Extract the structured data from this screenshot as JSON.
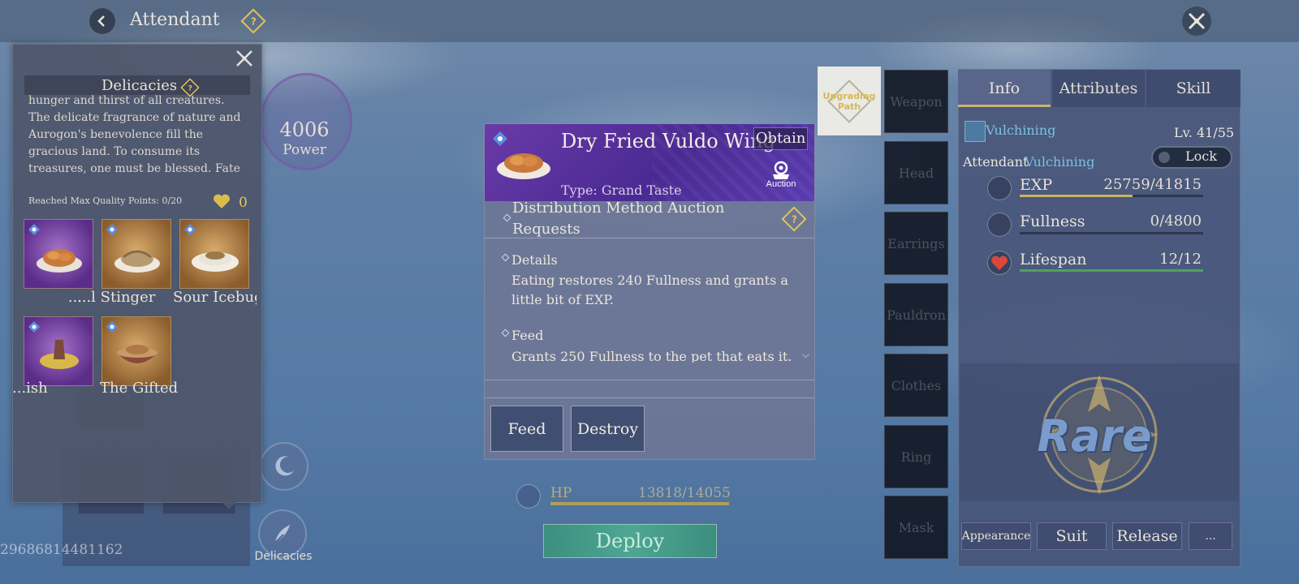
{
  "topbar": {
    "title": "Attendant",
    "help_icon": "question-diamond-icon",
    "close_icon": "close-icon"
  },
  "background": {
    "id_text": "29686814481162",
    "power_value": "4006",
    "power_label": "Power",
    "delicacies_button_label": "Delicacies"
  },
  "delicacies_panel": {
    "title": "Delicacies",
    "description": "hunger and thirst of all creatures. The delicate fragrance of nature and Aurogon's benevolence fill the gracious land. To consume its treasures, one must be blessed. Fate determines all.",
    "quality_text": "Reached Max Quality Points: 0/20",
    "heart_count": "0",
    "items": [
      {
        "label": "...",
        "tile": "purple"
      },
      {
        "label": "...l Stinger",
        "tile": "gold"
      },
      {
        "label": "Sour Icebug",
        "tile": "gold"
      },
      {
        "label": "...ish",
        "tile": "purple"
      },
      {
        "label": "The Gifted",
        "tile": "gold"
      }
    ]
  },
  "detail": {
    "name": "Dry Fried Vuldo Wing",
    "obtain_label": "Obtain",
    "type": "Type: Grand Taste",
    "auction_label": "Auction",
    "distribution": "Distribution Method    Auction Requests",
    "details_title": "Details",
    "details_body": "Eating restores 240 Fullness and grants a little bit of EXP.",
    "feed_title": "Feed",
    "feed_body": "Grants 250 Fullness to the pet that eats it.",
    "feed_button": "Feed",
    "destroy_button": "Destroy"
  },
  "hp": {
    "label": "HP",
    "value": "13818/14055",
    "fraction": 0.983
  },
  "deploy_label": "Deploy",
  "upgrading_path": "Upgrading Path",
  "equipment": [
    "Weapon",
    "Head",
    "Earrings",
    "Pauldron",
    "Clothes",
    "Ring",
    "Mask"
  ],
  "info_panel": {
    "tabs": [
      "Info",
      "Attributes",
      "Skill"
    ],
    "active_tab": "Info",
    "pet_name": "Vulchining",
    "level": "Lv. 41/55",
    "attendant_label": "Attendant",
    "attendant_name": "Vulchining",
    "lock_label": "Lock",
    "stats": [
      {
        "name": "EXP",
        "value": "25759/41815",
        "fraction": 0.616,
        "color": "#c8b45a"
      },
      {
        "name": "Fullness",
        "value": "0/4800",
        "fraction": 0.0,
        "color": "#c8b45a"
      },
      {
        "name": "Lifespan",
        "value": "12/12",
        "fraction": 1.0,
        "color": "#4fa35a"
      }
    ],
    "rarity": "Rare",
    "buttons": [
      "Appearance",
      "Suit",
      "Release",
      "..."
    ]
  }
}
